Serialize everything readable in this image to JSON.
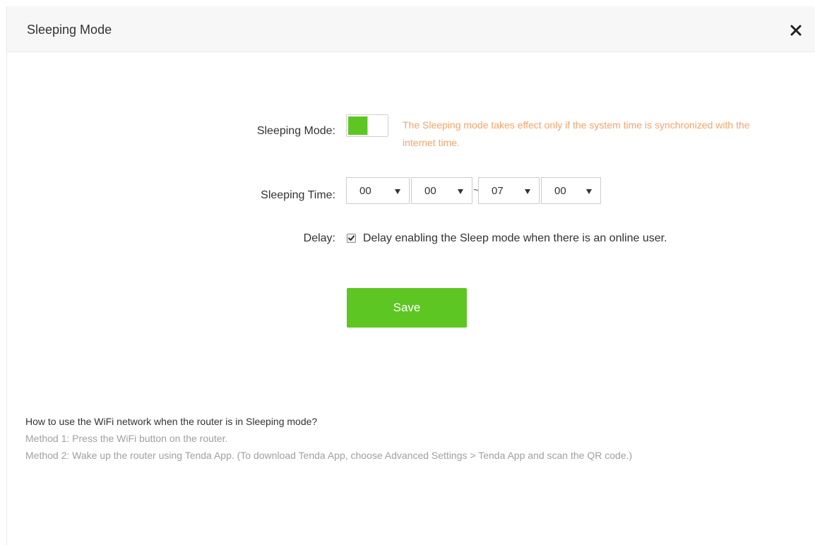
{
  "dialog": {
    "title": "Sleeping Mode",
    "close_icon": "close-icon"
  },
  "form": {
    "sleeping_mode": {
      "label": "Sleeping Mode:",
      "enabled": true,
      "note": "The Sleeping mode takes effect only if the system time is synchronized with the internet time."
    },
    "sleeping_time": {
      "label": "Sleeping Time:",
      "start_hour": "00",
      "start_minute": "00",
      "end_hour": "07",
      "end_minute": "00",
      "colon": ":",
      "tilde": "~"
    },
    "delay": {
      "label": "Delay:",
      "checked": true,
      "text": "Delay enabling the Sleep mode when there is an online user."
    },
    "save_label": "Save"
  },
  "help": {
    "question": "How to use the WiFi network when the router is in Sleeping mode?",
    "method1": "Method 1: Press the WiFi button on the router.",
    "method2": "Method 2: Wake up the router using Tenda App. (To download Tenda App, choose Advanced Settings > Tenda App and scan the QR code.)"
  },
  "colors": {
    "accent_green": "#5ec623",
    "note_orange": "#f5a36a",
    "muted_gray": "#a0a0a0"
  }
}
